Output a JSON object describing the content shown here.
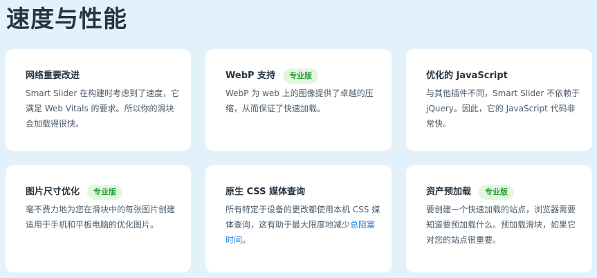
{
  "page_title": "速度与性能",
  "cards": [
    {
      "title": "网络重要改进",
      "description": "Smart Slider 在构建时考虑到了速度，它满足 Web Vitals 的要求。所以你的滑块会加载得很快。"
    },
    {
      "title": "WebP 支持",
      "badge": "专业版",
      "description": "WebP 为 web 上的图像提供了卓越的压缩，从而保证了快速加载。"
    },
    {
      "title": "优化的 JavaScript",
      "description": "与其他插件不同，Smart Slider 不依赖于 jQuery。因此，它的 JavaScript 代码非常快。"
    },
    {
      "title": "图片尺寸优化",
      "badge": "专业版",
      "description": "毫不费力地为您在滑块中的每张图片创建适用于手机和平板电脑的优化图片。"
    },
    {
      "title": "原生 CSS 媒体查询",
      "description": "所有特定于设备的更改都使用本机 CSS 媒体查询，这有助于最大限度地减少",
      "link": "总阻塞时间",
      "description_end": "。"
    },
    {
      "title": "资产预加载",
      "badge": "专业版",
      "description": "要创建一个快速加载的站点，浏览器需要知道要预加载什么。预加载滑块，如果它对您的站点很重要。"
    }
  ]
}
